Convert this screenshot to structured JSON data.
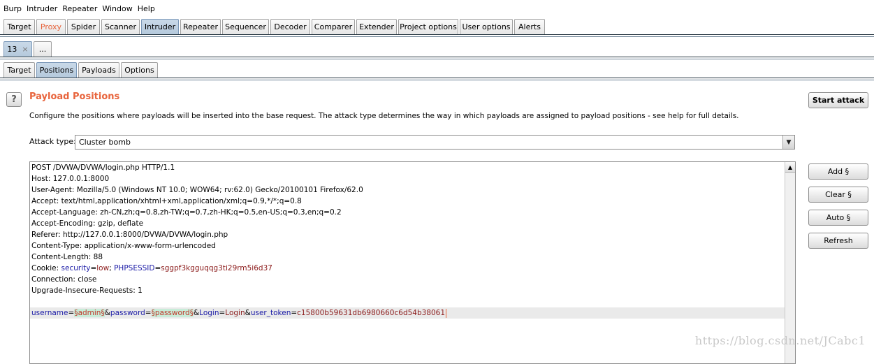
{
  "menu": [
    "Burp",
    "Intruder",
    "Repeater",
    "Window",
    "Help"
  ],
  "main_tabs": [
    "Target",
    "Proxy",
    "Spider",
    "Scanner",
    "Intruder",
    "Repeater",
    "Sequencer",
    "Decoder",
    "Comparer",
    "Extender",
    "Project options",
    "User options",
    "Alerts"
  ],
  "instance_tabs": {
    "current": "13",
    "close": "×",
    "more": "..."
  },
  "sub_tabs": [
    "Target",
    "Positions",
    "Payloads",
    "Options"
  ],
  "section": {
    "help": "?",
    "title": "Payload Positions",
    "description": "Configure the positions where payloads will be inserted into the base request. The attack type determines the way in which payloads are assigned to payload positions - see help for full details."
  },
  "attack": {
    "label": "Attack type:",
    "value": "Cluster bomb"
  },
  "buttons": {
    "start_attack": "Start attack",
    "add": "Add §",
    "clear": "Clear §",
    "auto": "Auto §",
    "refresh": "Refresh"
  },
  "request": {
    "lines": [
      "POST /DVWA/DVWA/login.php HTTP/1.1",
      "Host: 127.0.0.1:8000",
      "User-Agent: Mozilla/5.0 (Windows NT 10.0; WOW64; rv:62.0) Gecko/20100101 Firefox/62.0",
      "Accept: text/html,application/xhtml+xml,application/xml;q=0.9,*/*;q=0.8",
      "Accept-Language: zh-CN,zh;q=0.8,zh-TW;q=0.7,zh-HK;q=0.5,en-US;q=0.3,en;q=0.2",
      "Accept-Encoding: gzip, deflate",
      "Referer: http://127.0.0.1:8000/DVWA/DVWA/login.php",
      "Content-Type: application/x-www-form-urlencoded",
      "Content-Length: 88"
    ],
    "cookie": {
      "prefix": "Cookie: ",
      "k1": "security",
      "eq1": "=",
      "v1": "low",
      "sep": "; ",
      "k2": "PHPSESSID",
      "eq2": "=",
      "v2": "sggpf3kgguqqg3ti29rm5i6d37"
    },
    "lines_after_cookie": [
      "Connection: close",
      "Upgrade-Insecure-Requests: 1"
    ],
    "body": {
      "k1": "username",
      "eq": "=",
      "p1": "§admin§",
      "amp1": "&",
      "k2": "password",
      "p2": "§password§",
      "amp2": "&",
      "k3": "Login",
      "v3": "Login",
      "amp3": "&",
      "k4": "user_token",
      "v4": "c15800b59631db6980660c6d54b38061"
    }
  },
  "watermark": "https://blog.csdn.net/JCabc1"
}
